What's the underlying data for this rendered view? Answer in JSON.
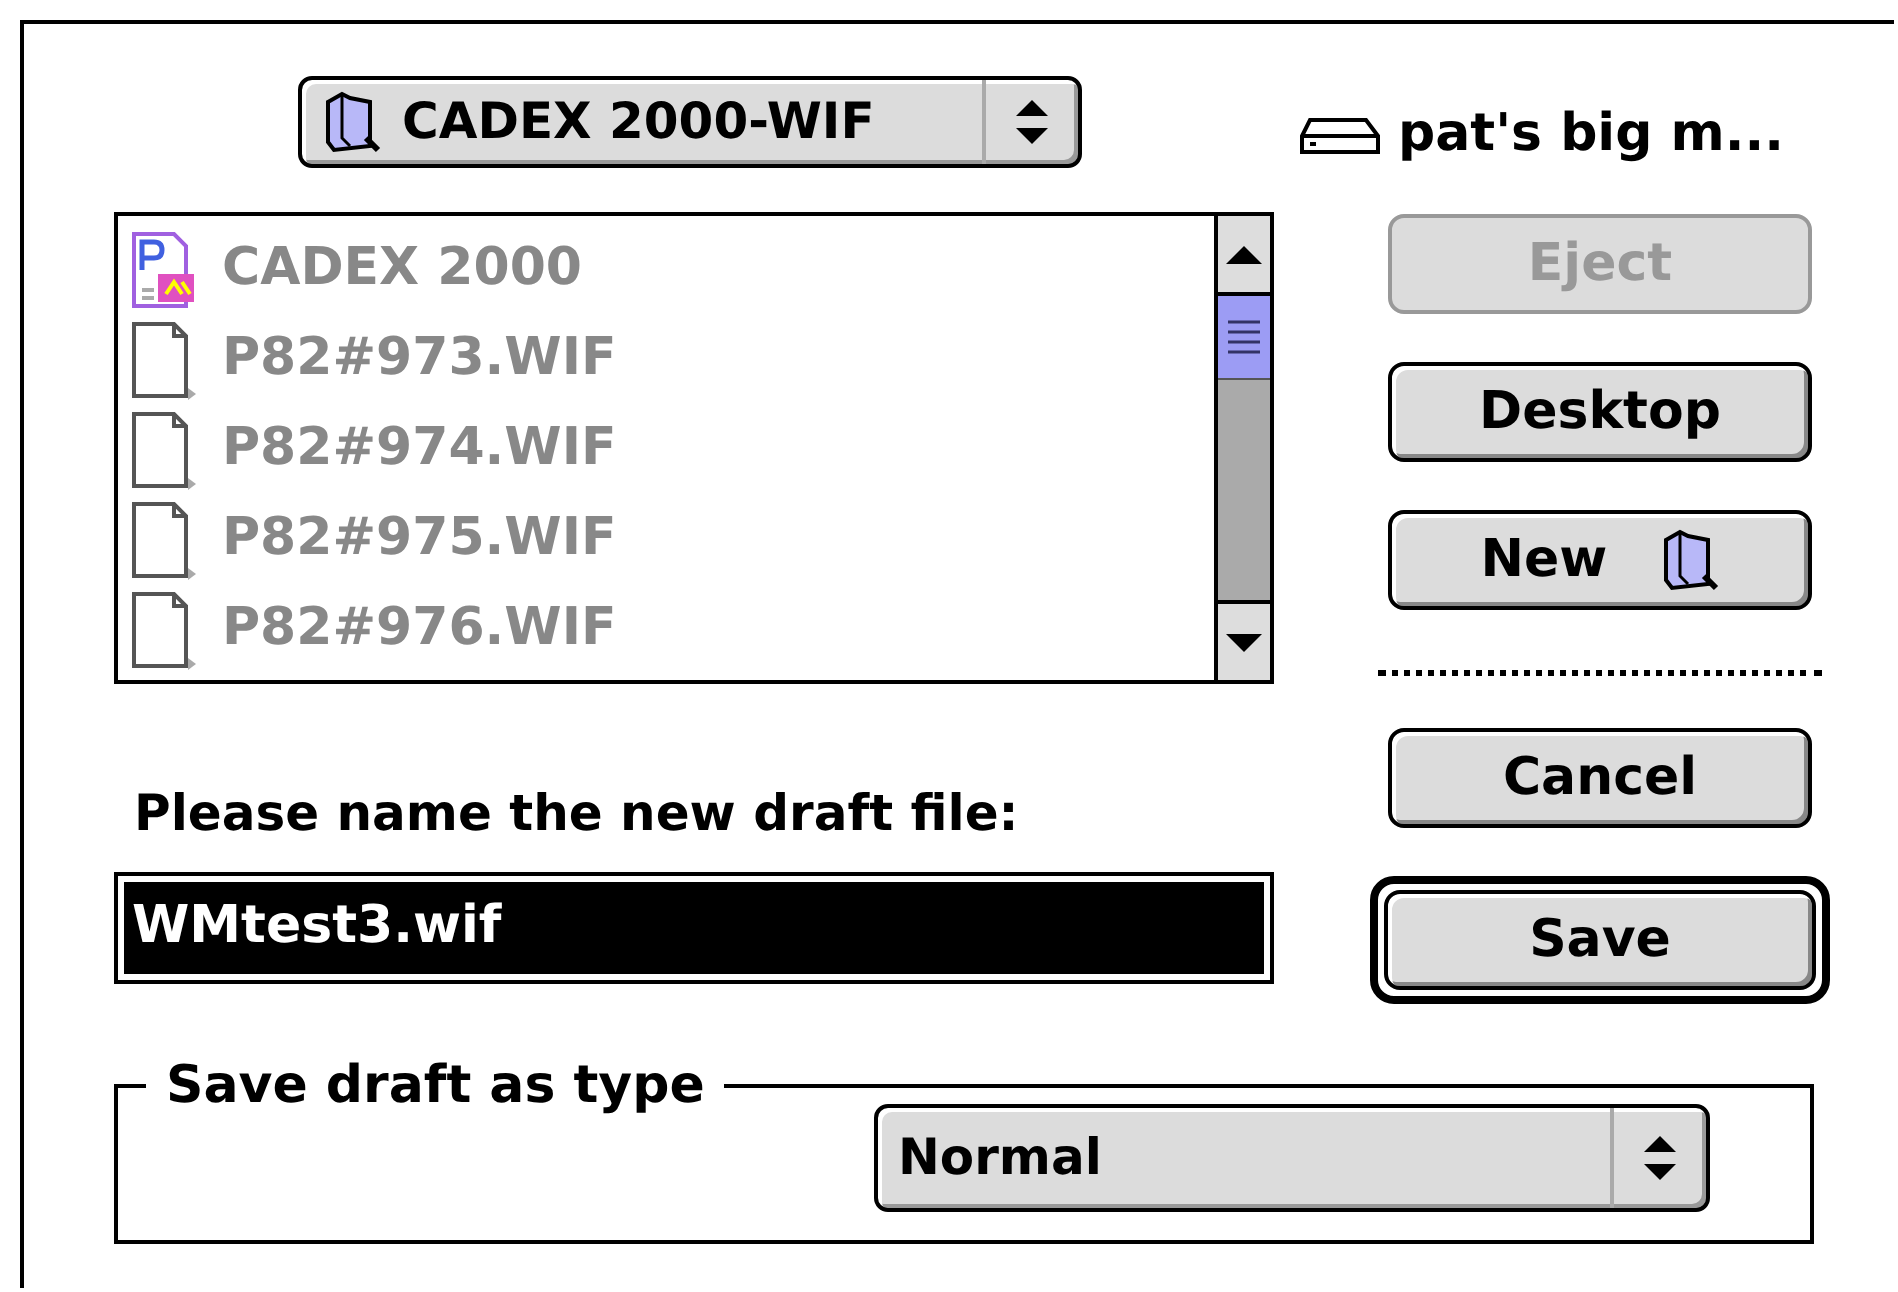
{
  "folder_popup": {
    "label": "CADEX 2000-WIF"
  },
  "disk": {
    "label": "pat's big m..."
  },
  "files": [
    {
      "name": "CADEX 2000",
      "kind": "application",
      "disabled": true
    },
    {
      "name": "P82#973.WIF",
      "kind": "document",
      "disabled": true
    },
    {
      "name": "P82#974.WIF",
      "kind": "document",
      "disabled": true
    },
    {
      "name": "P82#975.WIF",
      "kind": "document",
      "disabled": true
    },
    {
      "name": "P82#976.WIF",
      "kind": "document",
      "disabled": true
    }
  ],
  "nav_buttons": [
    {
      "label": "Eject",
      "kind": "plain",
      "disabled": true
    },
    {
      "label": "Desktop",
      "kind": "plain",
      "disabled": false
    },
    {
      "label": "New",
      "kind": "folder",
      "disabled": false
    }
  ],
  "action_buttons": [
    {
      "label": "Cancel",
      "disabled": false,
      "default": false
    },
    {
      "label": "Save",
      "disabled": false,
      "default": true
    }
  ],
  "prompt": "Please name the new draft file:",
  "filename": {
    "value": "WMtest3.wif",
    "selected": true
  },
  "type_group": {
    "title": "Save draft as type",
    "popup": {
      "value": "Normal"
    }
  }
}
